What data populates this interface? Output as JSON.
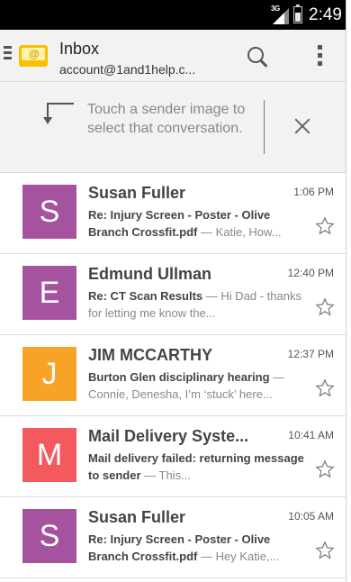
{
  "status_bar": {
    "network": "3G",
    "time": "2:49"
  },
  "header": {
    "title": "Inbox",
    "account": "account@1and1help.c..."
  },
  "tip": {
    "text": "Touch a sender image to select that conversation."
  },
  "colors": {
    "purple": "#a5529f",
    "orange": "#f8a326",
    "red": "#f25a5f"
  },
  "messages": [
    {
      "initial": "S",
      "color": "#a5529f",
      "sender": "Susan Fuller",
      "time": "1:06 PM",
      "subject": "Re: Injury Screen - Poster - Olive Branch Crossfit.pdf",
      "snippet": " — Katie, How..."
    },
    {
      "initial": "E",
      "color": "#a5529f",
      "sender": "Edmund Ullman",
      "time": "12:40 PM",
      "subject": "Re: CT Scan Results",
      "snippet": " — Hi Dad - thanks for letting me know the..."
    },
    {
      "initial": "J",
      "color": "#f8a326",
      "sender": "JIM MCCARTHY",
      "time": "12:37 PM",
      "subject": "Burton Glen disciplinary hearing",
      "snippet": " — Connie, Denesha, I’m ‘stuck’ here..."
    },
    {
      "initial": "M",
      "color": "#f25a5f",
      "sender": "Mail Delivery Syste...",
      "time": "10:41 AM",
      "subject": "Mail delivery failed: returning message to sender",
      "snippet": " — This..."
    },
    {
      "initial": "S",
      "color": "#a5529f",
      "sender": "Susan Fuller",
      "time": "10:05 AM",
      "subject": "Re: Injury Screen - Poster - Olive Branch Crossfit.pdf",
      "snippet": " — Hey Katie,..."
    }
  ]
}
